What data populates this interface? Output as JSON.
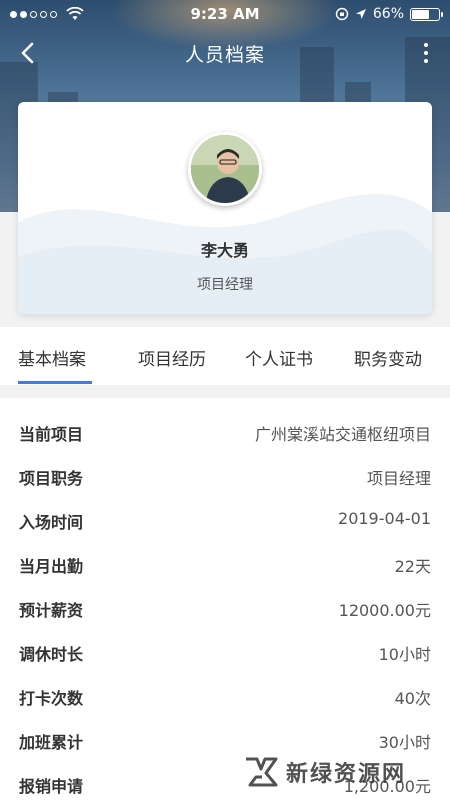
{
  "status_bar": {
    "time": "9:23 AM",
    "battery": "66%",
    "battery_level": 0.66,
    "signal_bars_filled": 2,
    "signal_bars_total": 5
  },
  "nav": {
    "title": "人员档案",
    "back_icon": "chevron-left-icon",
    "more_icon": "more-vertical-icon"
  },
  "profile": {
    "name": "李大勇",
    "role": "项目经理"
  },
  "tabs": [
    {
      "label": "基本档案",
      "active": true
    },
    {
      "label": "项目经历",
      "active": false
    },
    {
      "label": "个人证书",
      "active": false
    },
    {
      "label": "职务变动",
      "active": false
    }
  ],
  "info_rows": [
    {
      "label": "当前项目",
      "value": "广州棠溪站交通枢纽项目"
    },
    {
      "label": "项目职务",
      "value": "项目经理"
    },
    {
      "label": "入场时间",
      "value": "2019-04-01"
    },
    {
      "label": "当月出勤",
      "value": "22天"
    },
    {
      "label": "预计薪资",
      "value": "12000.00元"
    },
    {
      "label": "调休时长",
      "value": "10小时"
    },
    {
      "label": "打卡次数",
      "value": "40次"
    },
    {
      "label": "加班累计",
      "value": "30小时"
    },
    {
      "label": "报销申请",
      "value": "1,200.00元"
    }
  ],
  "watermark": {
    "text": "新绿资源网"
  },
  "colors": {
    "accent": "#3f7fd6",
    "header_bg": "#4b7194"
  }
}
